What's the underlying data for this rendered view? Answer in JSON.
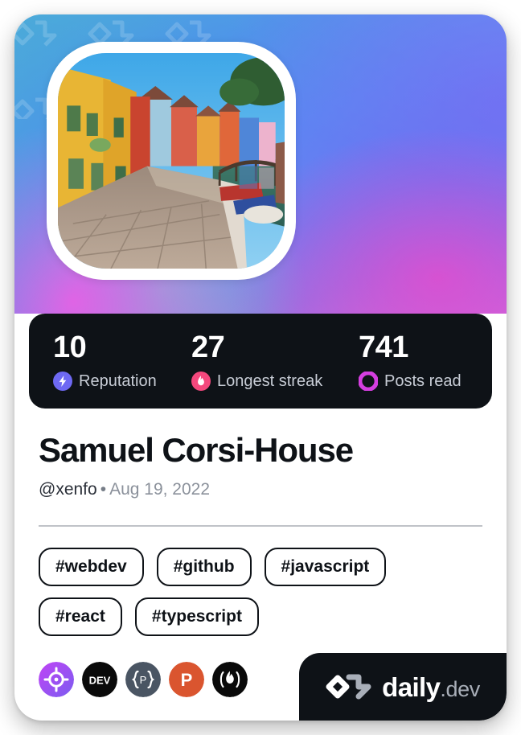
{
  "card": {
    "type": "devcard",
    "cover_gradient": [
      "#49a6dc",
      "#5a8cf2",
      "#6b7ef0",
      "#8f73e6",
      "#c46de0",
      "#e960e5"
    ],
    "background": "#ffffff"
  },
  "avatar": {
    "alt": "Colorful canal houses in Burano, Venice",
    "frame_color": "#ffffff"
  },
  "stats": [
    {
      "value": "10",
      "label": "Reputation",
      "icon": "lightning-bolt-icon",
      "color": "#6e69f3"
    },
    {
      "value": "27",
      "label": "Longest streak",
      "icon": "flame-icon",
      "color": "#f4487d"
    },
    {
      "value": "741",
      "label": "Posts read",
      "icon": "ring-icon",
      "color": "#d53ee0"
    }
  ],
  "stats_bar": {
    "background": "#0e1217",
    "value_color": "#ffffff",
    "label_color": "#c8cdd6"
  },
  "profile": {
    "name": "Samuel Corsi-House",
    "handle": "@xenfo",
    "separator": "•",
    "joined_date": "Aug 19, 2022",
    "name_color": "#0e1217"
  },
  "tags": [
    {
      "label": "#webdev"
    },
    {
      "label": "#github"
    },
    {
      "label": "#javascript"
    },
    {
      "label": "#react"
    },
    {
      "label": "#typescript"
    }
  ],
  "badges": [
    {
      "name": "codepen-target-badge",
      "icon": "crosshair-icon",
      "color": "#b44bf0",
      "text": ""
    },
    {
      "name": "devto-badge",
      "icon": "dev-icon",
      "color": "#0a0a0a",
      "text": "DEV"
    },
    {
      "name": "polywork-badge",
      "icon": "braces-p-icon",
      "color": "#4a5563",
      "text": "P"
    },
    {
      "name": "producthunt-badge",
      "icon": "ph-p-icon",
      "color": "#da552f",
      "text": "P"
    },
    {
      "name": "hashnode-flame-badge",
      "icon": "flame-circle-icon",
      "color": "#0a0a0a",
      "text": ""
    }
  ],
  "footer": {
    "brand_primary": "daily",
    "brand_secondary": ".dev",
    "logo": "daily-dev-logo",
    "background": "#0e1217"
  }
}
